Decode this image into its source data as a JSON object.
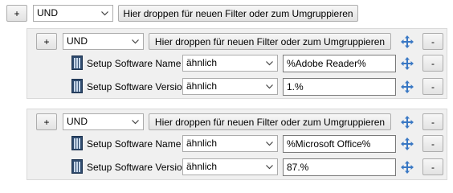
{
  "root": {
    "add_label": "+",
    "operator": "UND",
    "drop_zone": "Hier droppen für neuen Filter oder zum Umgruppieren"
  },
  "groups": [
    {
      "add_label": "+",
      "operator": "UND",
      "drop_zone": "Hier droppen für neuen Filter oder zum Umgruppieren",
      "remove_label": "-",
      "conditions": [
        {
          "field": "Setup Software Name",
          "operator": "ähnlich",
          "value": "%Adobe Reader%",
          "remove_label": "-"
        },
        {
          "field": "Setup Software Version",
          "operator": "ähnlich",
          "value": "1.%",
          "remove_label": "-"
        }
      ]
    },
    {
      "add_label": "+",
      "operator": "UND",
      "drop_zone": "Hier droppen für neuen Filter oder zum Umgruppieren",
      "remove_label": "-",
      "conditions": [
        {
          "field": "Setup Software Name",
          "operator": "ähnlich",
          "value": "%Microsoft Office%",
          "remove_label": "-"
        },
        {
          "field": "Setup Software Version",
          "operator": "ähnlich",
          "value": "87.%",
          "remove_label": "-"
        }
      ]
    }
  ],
  "icons": {
    "condition": "filter-condition-icon",
    "move": "move-arrows-icon",
    "dropdown": "chevron-down-icon"
  },
  "colors": {
    "move_icon": "#3a78c4",
    "condition_icon": "#2f4b6e",
    "group_background": "#f0f0f0"
  }
}
